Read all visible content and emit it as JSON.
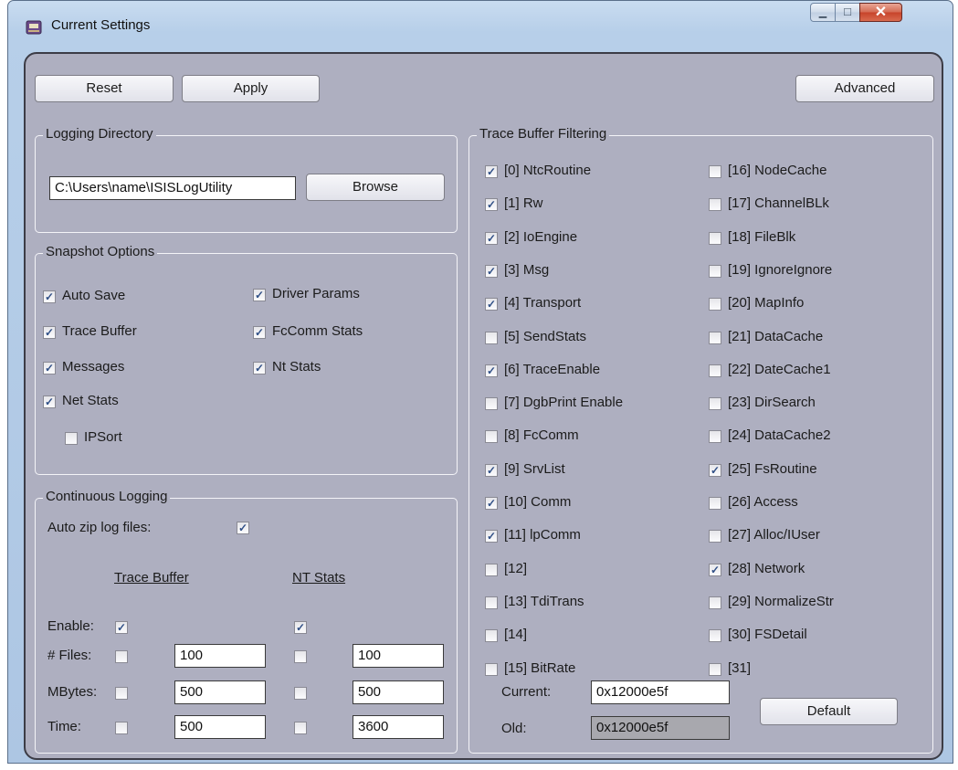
{
  "window": {
    "title": "Current Settings",
    "close_glyph": "✕",
    "min_glyph": "▁",
    "max_glyph": "□"
  },
  "toolbar": {
    "reset_label": "Reset",
    "apply_label": "Apply",
    "advanced_label": "Advanced"
  },
  "logging_dir": {
    "title": "Logging Directory",
    "path": "C:\\Users\\name\\ISISLogUtility",
    "browse_label": "Browse"
  },
  "snapshot": {
    "title": "Snapshot Options",
    "options": [
      {
        "label": "Auto Save",
        "checked": true
      },
      {
        "label": "Trace Buffer",
        "checked": true
      },
      {
        "label": "Messages",
        "checked": true
      },
      {
        "label": "Net Stats",
        "checked": true
      },
      {
        "label": "IPSort",
        "checked": false
      },
      {
        "label": "Driver Params",
        "checked": true
      },
      {
        "label": "FcComm Stats",
        "checked": true
      },
      {
        "label": "Nt Stats",
        "checked": true
      }
    ]
  },
  "continuous": {
    "title": "Continuous Logging",
    "auto_zip_label": "Auto zip log files:",
    "auto_zip": true,
    "trace_header": "Trace Buffer",
    "nt_header": "NT Stats",
    "rows": [
      {
        "label": "Enable:",
        "trace_checked": true,
        "trace_value": "",
        "nt_checked": true,
        "nt_value": ""
      },
      {
        "label": "# Files:",
        "trace_checked": false,
        "trace_value": "100",
        "nt_checked": false,
        "nt_value": "100"
      },
      {
        "label": "MBytes:",
        "trace_checked": false,
        "trace_value": "500",
        "nt_checked": false,
        "nt_value": "500"
      },
      {
        "label": "Time:",
        "trace_checked": false,
        "trace_value": "500",
        "nt_checked": false,
        "nt_value": "3600"
      }
    ]
  },
  "trace_filter": {
    "title": "Trace Buffer Filtering",
    "items": [
      {
        "label": "[0] NtcRoutine",
        "checked": true
      },
      {
        "label": "[1] Rw",
        "checked": true
      },
      {
        "label": "[2] IoEngine",
        "checked": true
      },
      {
        "label": "[3] Msg",
        "checked": true
      },
      {
        "label": "[4] Transport",
        "checked": true
      },
      {
        "label": "[5] SendStats",
        "checked": false
      },
      {
        "label": "[6] TraceEnable",
        "checked": true
      },
      {
        "label": "[7] DgbPrint Enable",
        "checked": false
      },
      {
        "label": "[8] FcComm",
        "checked": false
      },
      {
        "label": "[9] SrvList",
        "checked": true
      },
      {
        "label": "[10] Comm",
        "checked": true
      },
      {
        "label": "[11] lpComm",
        "checked": true
      },
      {
        "label": "[12]",
        "checked": false
      },
      {
        "label": "[13] TdiTrans",
        "checked": false
      },
      {
        "label": "[14]",
        "checked": false
      },
      {
        "label": "[15] BitRate",
        "checked": false
      },
      {
        "label": "[16] NodeCache",
        "checked": false
      },
      {
        "label": "[17] ChannelBLk",
        "checked": false
      },
      {
        "label": "[18] FileBlk",
        "checked": false
      },
      {
        "label": "[19] IgnoreIgnore",
        "checked": false
      },
      {
        "label": "[20] MapInfo",
        "checked": false
      },
      {
        "label": "[21] DataCache",
        "checked": false
      },
      {
        "label": "[22] DateCache1",
        "checked": false
      },
      {
        "label": "[23] DirSearch",
        "checked": false
      },
      {
        "label": "[24] DataCache2",
        "checked": false
      },
      {
        "label": "[25] FsRoutine",
        "checked": true
      },
      {
        "label": "[26] Access",
        "checked": false
      },
      {
        "label": "[27] Alloc/IUser",
        "checked": false
      },
      {
        "label": "[28] Network",
        "checked": true
      },
      {
        "label": "[29] NormalizeStr",
        "checked": false
      },
      {
        "label": "[30] FSDetail",
        "checked": false
      },
      {
        "label": "[31]",
        "checked": false
      }
    ],
    "current_label": "Current:",
    "current_value": "0x12000e5f",
    "old_label": "Old:",
    "old_value": "0x12000e5f",
    "default_label": "Default"
  },
  "check_glyph": "✓"
}
